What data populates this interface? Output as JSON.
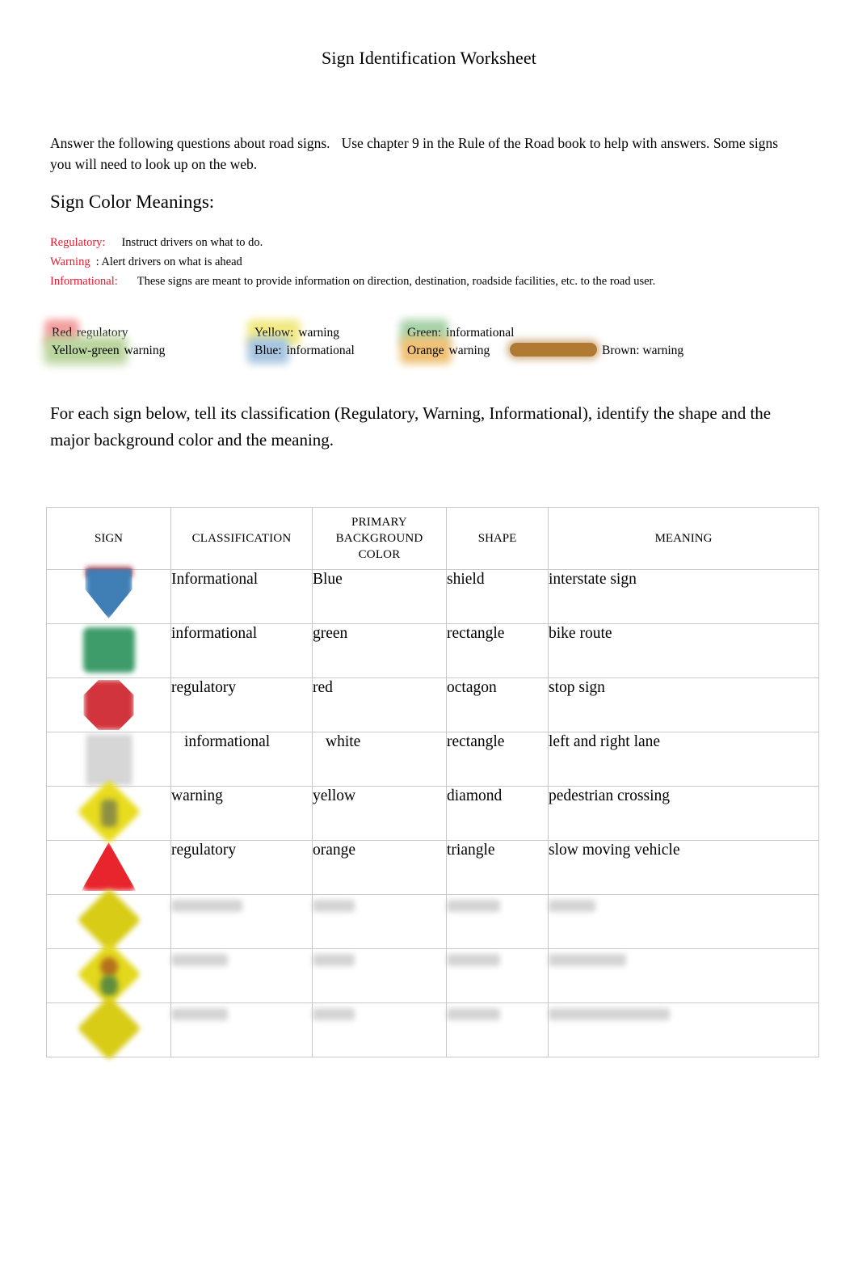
{
  "document": {
    "title": "Sign Identification Worksheet",
    "intro_line_1a": "Answer the following questions about road signs.",
    "intro_line_1b": "Use chapter 9 in the Rule of the Road book to help with answers.",
    "intro_line_2": "Some signs you will need to look up on the web.",
    "section_heading": "Sign Color Meanings:",
    "task_paragraph": "For each sign below, tell its classification (Regulatory, Warning, Informational), identify the shape and the major background color and the meaning."
  },
  "definitions": [
    {
      "term": "Regulatory:",
      "text": "Instruct drivers on what to do."
    },
    {
      "term": "Warning",
      "text": ": Alert drivers on what is ahead"
    },
    {
      "term": "Informational:",
      "text": "These signs are meant to provide information on direction, destination, roadside facilities, etc. to the road user."
    }
  ],
  "legend": {
    "col1": [
      {
        "color_word": "Red",
        "meaning": "regulatory",
        "hex": "#f3a0a0"
      },
      {
        "color_word": "Yellow-green",
        "meaning": "warning",
        "hex": "#bcd6a0"
      }
    ],
    "col2": [
      {
        "color_word": "Yellow:",
        "meaning": "warning",
        "hex": "#f2ea86"
      },
      {
        "color_word": "Blue:",
        "meaning": "informational",
        "hex": "#a9c6e0"
      }
    ],
    "col3": [
      {
        "color_word": "Green:",
        "meaning": "informational",
        "hex": "#a9d3a9"
      },
      {
        "color_word": "Orange",
        "meaning": "warning",
        "hex": "#f0c277"
      }
    ],
    "col4": [
      {
        "color_word": "Brown:",
        "meaning": "warning",
        "hex": "#b07a33"
      }
    ]
  },
  "table": {
    "headers": {
      "sign": "SIGN",
      "classification": "CLASSIFICATION",
      "background_color": "PRIMARY BACKGROUND COLOR",
      "background_color_l1": "PRIMARY",
      "background_color_l2": "BACKGROUND",
      "background_color_l3": "COLOR",
      "shape": "SHAPE",
      "meaning": "MEANING"
    },
    "rows": [
      {
        "sign_icon": "interstate-shield-sign",
        "classification": "Informational",
        "background_color": "Blue",
        "shape": "shield",
        "meaning": "interstate sign",
        "redacted": false
      },
      {
        "sign_icon": "bike-route-sign",
        "classification": "informational",
        "background_color": "green",
        "shape": "rectangle",
        "meaning": "bike route",
        "redacted": false
      },
      {
        "sign_icon": "stop-sign",
        "classification": "regulatory",
        "background_color": "red",
        "shape": "octagon",
        "meaning": "stop sign",
        "redacted": false
      },
      {
        "sign_icon": "lane-use-sign",
        "classification": "informational",
        "background_color": "white",
        "shape": "rectangle",
        "meaning": "left and right lane",
        "redacted": false
      },
      {
        "sign_icon": "pedestrian-crossing-sign",
        "classification": "warning",
        "background_color": "yellow",
        "shape": "diamond",
        "meaning": "pedestrian crossing",
        "redacted": false
      },
      {
        "sign_icon": "slow-moving-vehicle-sign",
        "classification": "regulatory",
        "background_color": "orange",
        "shape": "triangle",
        "meaning": "slow moving vehicle",
        "redacted": false
      },
      {
        "sign_icon": "yellow-diamond-sign",
        "classification": "",
        "background_color": "",
        "shape": "",
        "meaning": "",
        "redacted": true,
        "widths": [
          88,
          52,
          66,
          58
        ]
      },
      {
        "sign_icon": "yellow-diamond-sign",
        "classification": "",
        "background_color": "",
        "shape": "",
        "meaning": "",
        "redacted": true,
        "widths": [
          70,
          52,
          66,
          96
        ]
      },
      {
        "sign_icon": "yellow-diamond-sign",
        "classification": "",
        "background_color": "",
        "shape": "",
        "meaning": "",
        "redacted": true,
        "widths": [
          70,
          52,
          66,
          150
        ]
      }
    ]
  }
}
